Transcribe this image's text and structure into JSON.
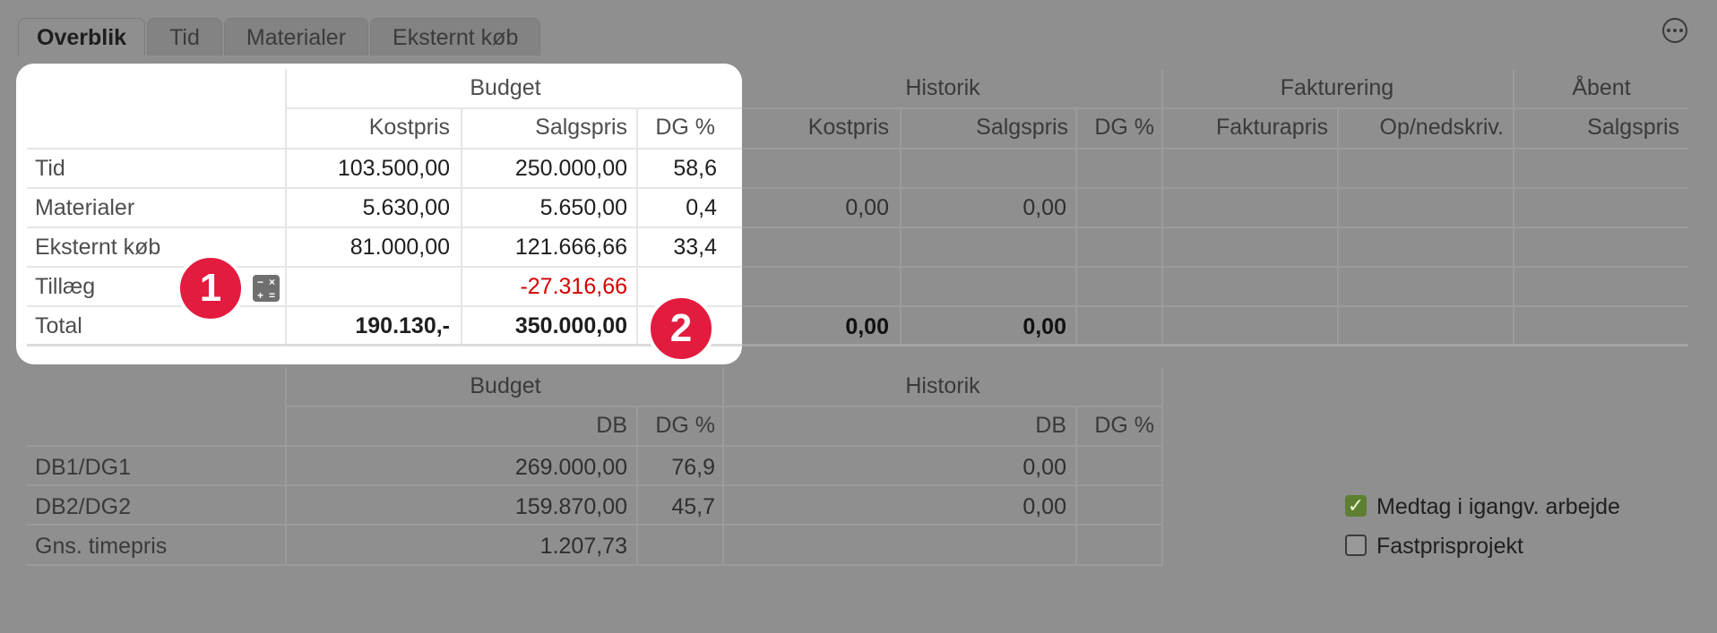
{
  "tabs": [
    "Overblik",
    "Tid",
    "Materialer",
    "Eksternt køb"
  ],
  "top_table": {
    "groups": [
      "Budget",
      "Historik",
      "Fakturering",
      "Åbent"
    ],
    "subheaders": [
      "Kostpris",
      "Salgspris",
      "DG %",
      "Kostpris",
      "Salgspris",
      "DG %",
      "Fakturapris",
      "Op/nedskriv.",
      "Salgspris"
    ],
    "rows": [
      {
        "label": "Tid",
        "cost": "103.500,00",
        "sale": "250.000,00",
        "dg": "58,6",
        "h_cost": "",
        "h_sale": ""
      },
      {
        "label": "Materialer",
        "cost": "5.630,00",
        "sale": "5.650,00",
        "dg": "0,4",
        "h_cost": "0,00",
        "h_sale": "0,00"
      },
      {
        "label": "Eksternt køb",
        "cost": "81.000,00",
        "sale": "121.666,66",
        "dg": "33,4",
        "h_cost": "",
        "h_sale": ""
      },
      {
        "label": "Tillæg",
        "cost": "",
        "sale": "-27.316,66",
        "dg": "",
        "h_cost": "",
        "h_sale": ""
      },
      {
        "label": "Total",
        "cost": "190.130,-",
        "sale": "350.000,00",
        "dg": "",
        "h_cost": "0,00",
        "h_sale": "0,00"
      }
    ]
  },
  "bottom_table": {
    "groups": [
      "Budget",
      "Historik"
    ],
    "subheaders": [
      "DB",
      "DG %",
      "DB",
      "DG %"
    ],
    "rows": [
      {
        "label": "DB1/DG1",
        "db": "269.000,00",
        "dg": "76,9",
        "h_db": "0,00"
      },
      {
        "label": "DB2/DG2",
        "db": "159.870,00",
        "dg": "45,7",
        "h_db": "0,00"
      },
      {
        "label": "Gns. timepris",
        "db": "1.207,73",
        "dg": "",
        "h_db": ""
      }
    ]
  },
  "checkboxes": [
    {
      "label": "Medtag i igangv. arbejde",
      "checked": true
    },
    {
      "label": "Fastprisprojekt",
      "checked": false
    }
  ],
  "badges": [
    "1",
    "2"
  ],
  "colors": {
    "accent_badge": "#e31b3f",
    "negative": "#d40000",
    "check": "#5d7f2f"
  }
}
